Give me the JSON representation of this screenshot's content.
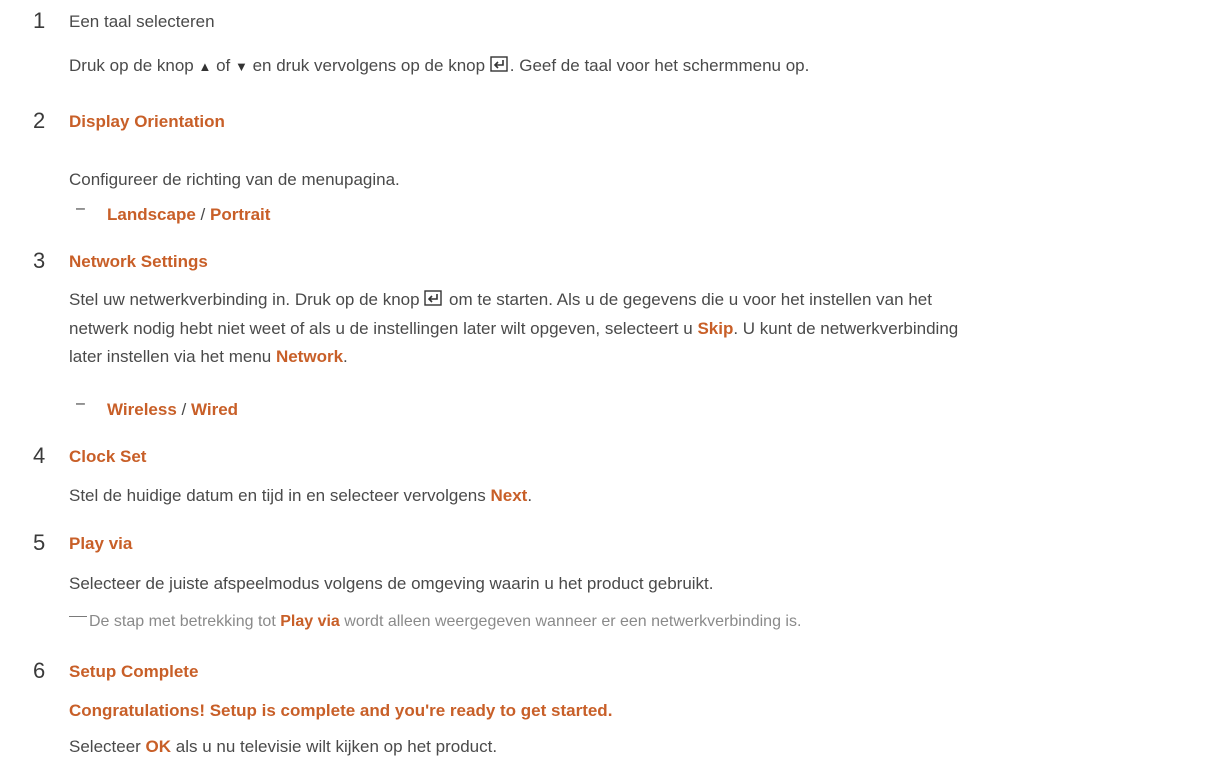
{
  "steps": [
    {
      "num": "1",
      "title": "Een taal selecteren",
      "text_a": "Druk op de knop ",
      "text_b": " of ",
      "text_c": " en druk vervolgens op de knop ",
      "text_d": ". Geef de taal voor het schermmenu op.",
      "icons": [
        "up-triangle-icon",
        "down-triangle-icon",
        "enter-icon"
      ]
    },
    {
      "num": "2",
      "title": "Display Orientation",
      "text": "Configureer de richting van de menupagina.",
      "option_a": "Landscape",
      "option_sep": " / ",
      "option_b": "Portrait"
    },
    {
      "num": "3",
      "title": "Network Settings",
      "line1_a": "Stel uw netwerkverbinding in. Druk op de knop ",
      "line1_b": " om te starten. Als u de gegevens die u voor het instellen van het",
      "line2_a": "netwerk nodig hebt niet weet of als u de instellingen later wilt opgeven, selecteert u ",
      "line2_skip": "Skip",
      "line2_b": ". U kunt de netwerkverbinding",
      "line3_a": "later instellen via het menu ",
      "line3_network": "Network",
      "line3_b": ".",
      "option_a": "Wireless",
      "option_sep": " / ",
      "option_b": "Wired",
      "icons": [
        "enter-icon"
      ]
    },
    {
      "num": "4",
      "title": "Clock Set",
      "text_a": "Stel de huidige datum en tijd in en selecteer vervolgens ",
      "text_next": "Next",
      "text_b": "."
    },
    {
      "num": "5",
      "title": "Play via",
      "text": "Selecteer de juiste afspeelmodus volgens de omgeving waarin u het product gebruikt.",
      "note_a": "De stap met betrekking tot ",
      "note_em": "Play via",
      "note_b": " wordt alleen weergegeven wanneer er een netwerkverbinding is."
    },
    {
      "num": "6",
      "title": "Setup Complete",
      "subtitle": "Congratulations! Setup is complete and you're ready to get started.",
      "text_a": "Selecteer ",
      "text_ok": "OK",
      "text_b": " als u nu televisie wilt kijken op het product."
    }
  ],
  "colors": {
    "accent": "#c85f28",
    "text": "#4a4a4a",
    "note": "#8a8a8a"
  }
}
